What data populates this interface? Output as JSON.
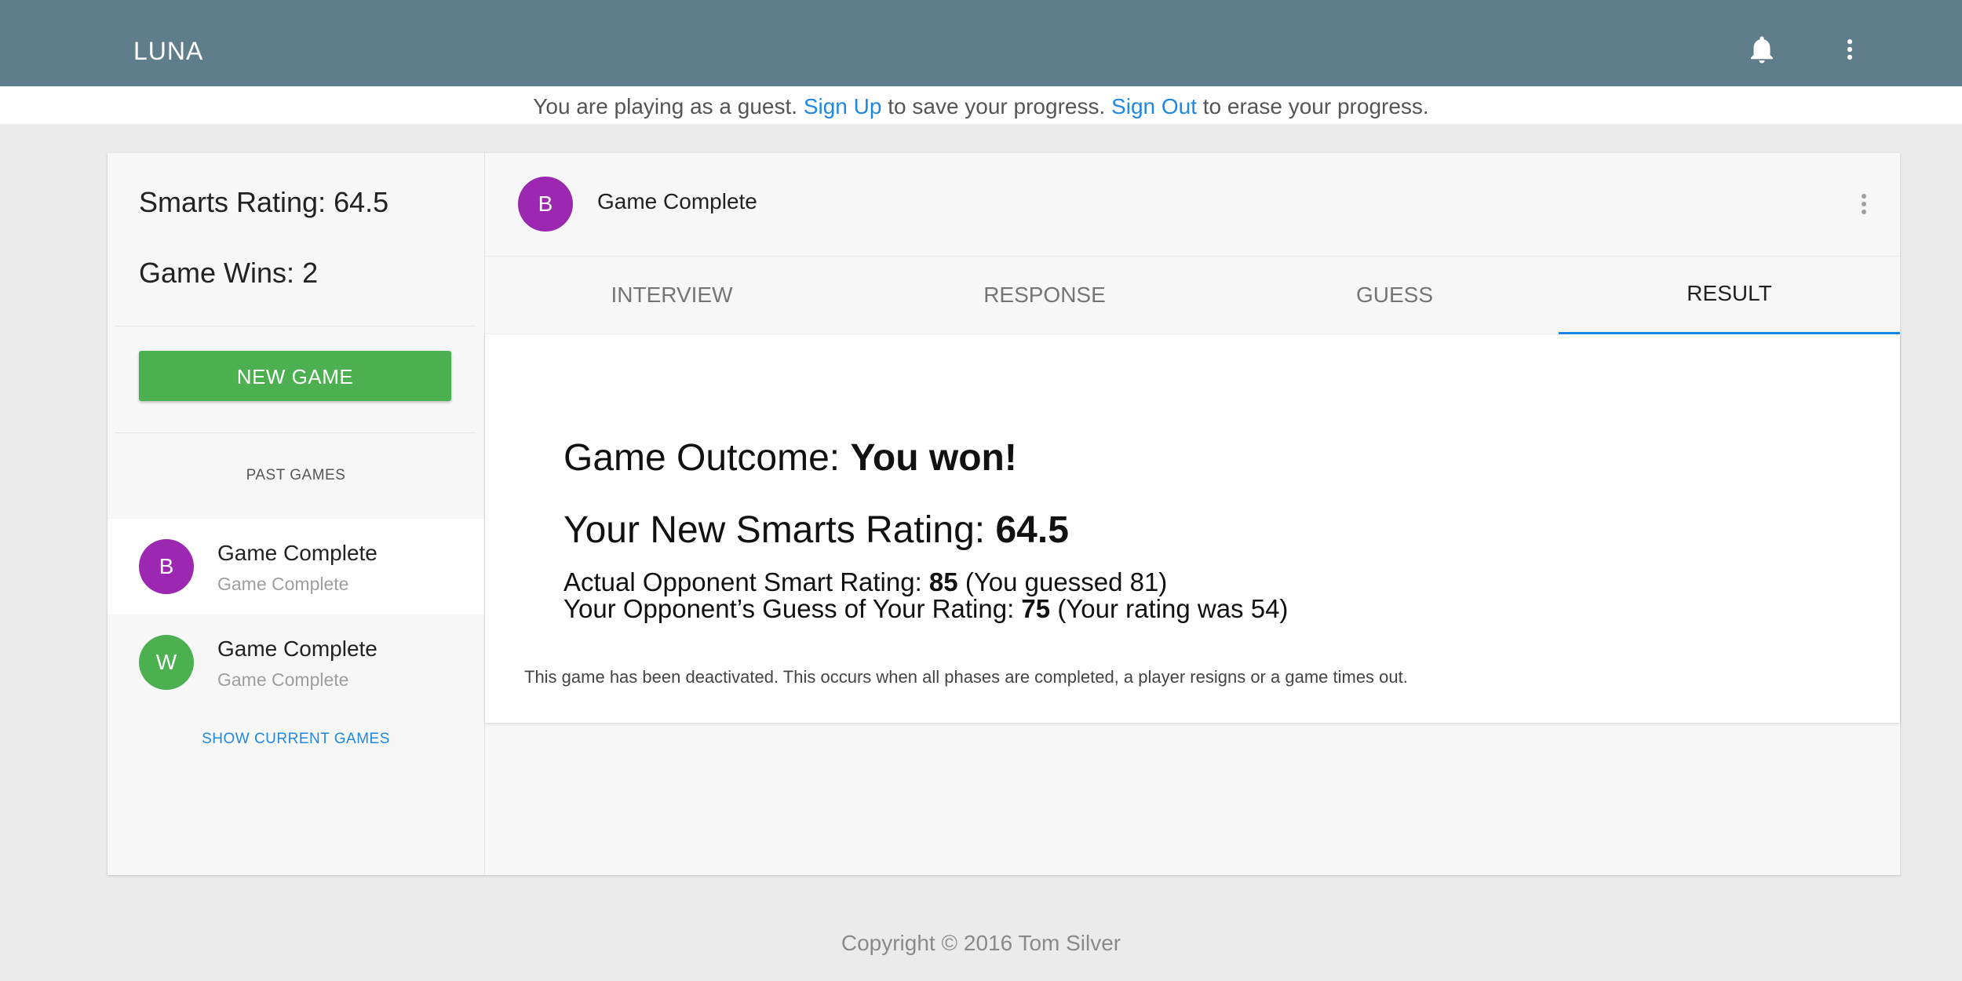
{
  "appbar": {
    "brand": "LUNA",
    "icons": {
      "notifications": "bell-icon",
      "menu": "more-vert-icon"
    },
    "color": "#607d8b"
  },
  "banner": {
    "text_1": "You are playing as a guest.",
    "sign_up": "Sign Up",
    "text_2": "to save your progress.",
    "sign_out": "Sign Out",
    "text_3": "to erase your progress."
  },
  "sidebar": {
    "smarts_rating_label": "Smarts Rating:",
    "smarts_rating_value": "64.5",
    "game_wins_label": "Game Wins:",
    "game_wins_value": "2",
    "new_game_label": "NEW GAME",
    "past_games_title": "PAST GAMES",
    "past_games": [
      {
        "avatar_letter": "B",
        "avatar_color": "#9c27b0",
        "title": "Game Complete",
        "subtitle": "Game Complete",
        "selected": true
      },
      {
        "avatar_letter": "W",
        "avatar_color": "#4caf50",
        "title": "Game Complete",
        "subtitle": "Game Complete",
        "selected": false
      }
    ],
    "show_current_label": "SHOW CURRENT GAMES"
  },
  "game": {
    "avatar_letter": "B",
    "title": "Game Complete",
    "tabs": [
      "INTERVIEW",
      "RESPONSE",
      "GUESS",
      "RESULT"
    ],
    "active_tab": "RESULT",
    "result": {
      "outcome_label": "Game Outcome:",
      "outcome_value": "You won!",
      "new_rating_label": "Your New Smarts Rating:",
      "new_rating_value": "64.5",
      "opponent_rating_label": "Actual Opponent Smart Rating:",
      "opponent_rating_value": "85",
      "opponent_rating_note": "(You guessed 81)",
      "opponent_guess_label": "Your Opponent’s Guess of Your Rating:",
      "opponent_guess_value": "75",
      "opponent_guess_note": "(Your rating was 54)",
      "deactivated_note": "This game has been deactivated. This occurs when all phases are completed, a player resigns or a game times out."
    }
  },
  "footer": {
    "copyright": "Copyright © 2016 Tom Silver"
  },
  "colors": {
    "accent": "#1e88e5",
    "success": "#4caf50",
    "purple": "#9c27b0"
  }
}
